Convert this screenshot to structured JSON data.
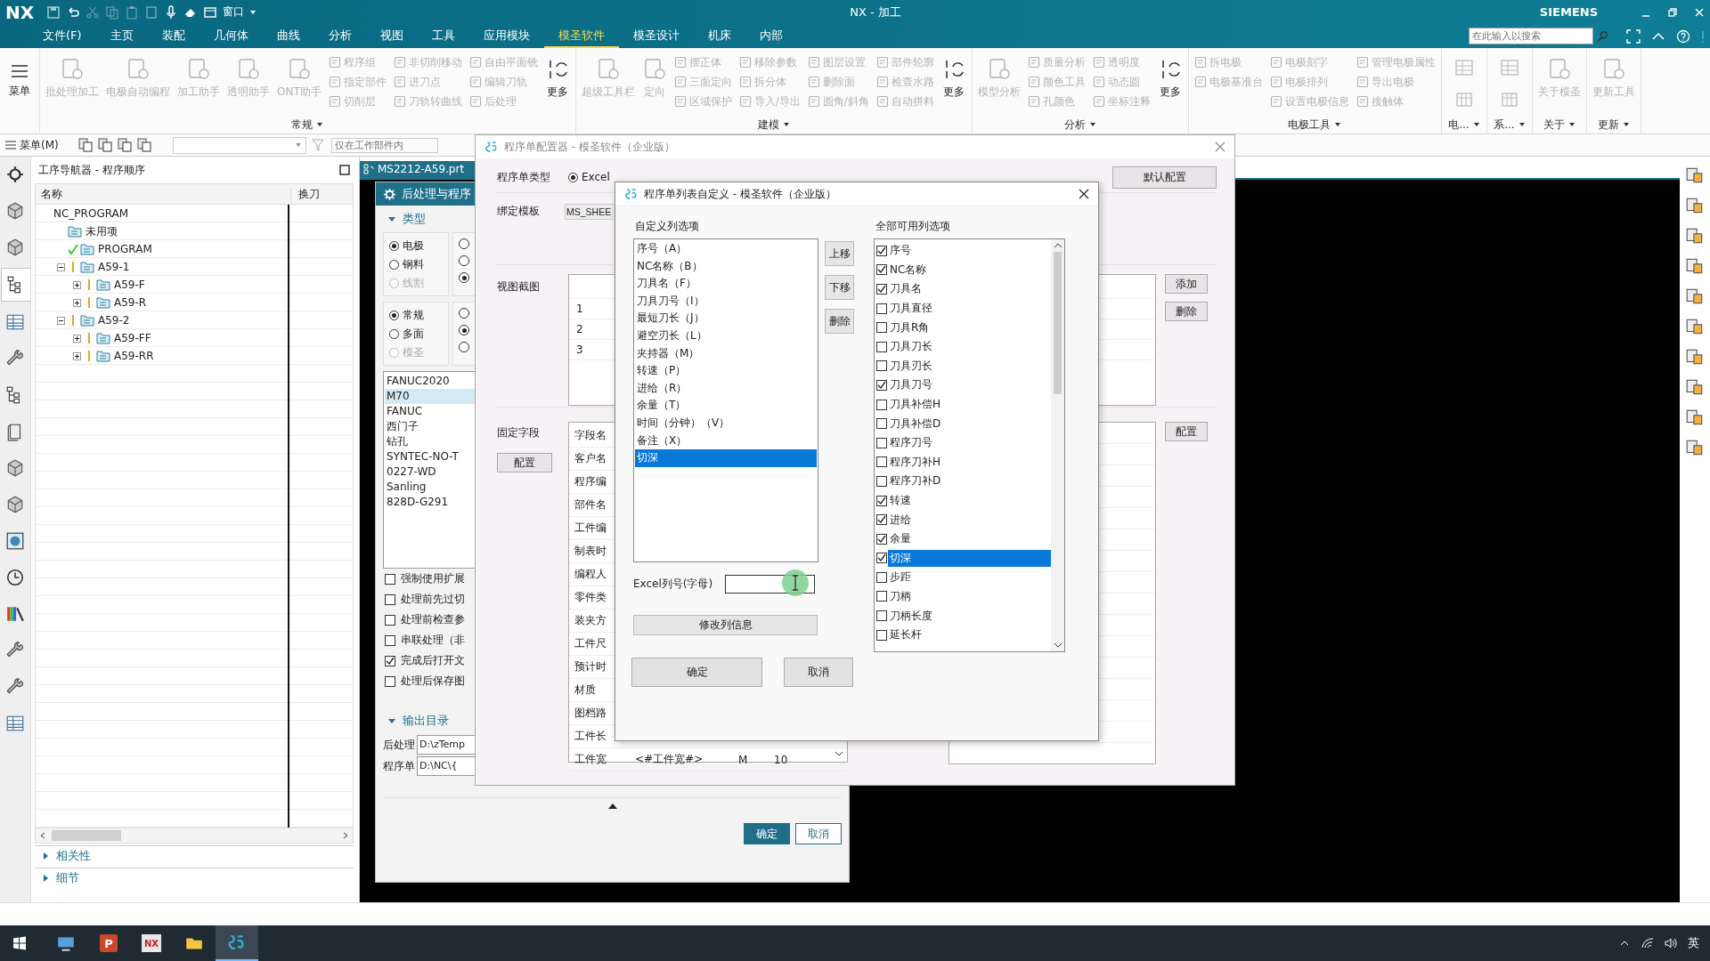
{
  "title_bar": {
    "logo": "NX",
    "window_menu": "窗口",
    "title": "NX - 加工",
    "brand": "SIEMENS"
  },
  "menu_bar": {
    "items": [
      {
        "label": "文件(F)",
        "selected": false
      },
      {
        "label": "主页",
        "selected": false
      },
      {
        "label": "装配",
        "selected": false
      },
      {
        "label": "几何体",
        "selected": false
      },
      {
        "label": "曲线",
        "selected": false
      },
      {
        "label": "分析",
        "selected": false
      },
      {
        "label": "视图",
        "selected": false
      },
      {
        "label": "工具",
        "selected": false
      },
      {
        "label": "应用模块",
        "selected": false
      },
      {
        "label": "模圣软件",
        "selected": true
      },
      {
        "label": "模圣设计",
        "selected": false
      },
      {
        "label": "机床",
        "selected": false
      },
      {
        "label": "内部",
        "selected": false
      }
    ],
    "search": {
      "placeholder": "在此输入以搜索"
    }
  },
  "ribbon": {
    "menu_button": "菜单",
    "groups": [
      {
        "label": "常规",
        "kind": "tools",
        "large": [
          {
            "label": "批处理加工",
            "disabled": true
          },
          {
            "label": "电极自动编程",
            "disabled": true
          },
          {
            "label": "加工助手",
            "disabled": true
          },
          {
            "label": "透明助手",
            "disabled": true
          },
          {
            "label": "ONT助手",
            "disabled": true
          }
        ],
        "columns": [
          [
            {
              "label": "程序组",
              "disabled": true
            },
            {
              "label": "指定部件",
              "disabled": true
            },
            {
              "label": "切削层",
              "disabled": true
            }
          ],
          [
            {
              "label": "非切削移动",
              "disabled": true
            },
            {
              "label": "进刀点",
              "disabled": true
            },
            {
              "label": "刀轨转曲线",
              "disabled": true
            }
          ],
          [
            {
              "label": "自由平面铣",
              "disabled": true
            },
            {
              "label": "编辑刀轨",
              "disabled": true
            },
            {
              "label": "后处理",
              "disabled": true
            }
          ]
        ],
        "more": {
          "label": "更多",
          "disabled": false
        }
      },
      {
        "label": "建模",
        "kind": "tools",
        "large": [
          {
            "label": "超级工具栏",
            "disabled": true
          },
          {
            "label": "定向",
            "disabled": true
          }
        ],
        "columns": [
          [
            {
              "label": "摆正体",
              "disabled": true
            },
            {
              "label": "三面定向",
              "disabled": true
            },
            {
              "label": "区域保护",
              "disabled": true
            }
          ],
          [
            {
              "label": "移除参数",
              "disabled": true
            },
            {
              "label": "拆分体",
              "disabled": true
            },
            {
              "label": "导入/导出",
              "disabled": true
            }
          ],
          [
            {
              "label": "图层设置",
              "disabled": true
            },
            {
              "label": "删除面",
              "disabled": true
            },
            {
              "label": "圆角/斜角",
              "disabled": true
            }
          ],
          [
            {
              "label": "部件轮廓",
              "disabled": true
            },
            {
              "label": "检查水路",
              "disabled": true
            },
            {
              "label": "自动拼料",
              "disabled": true
            }
          ]
        ],
        "more": {
          "label": "更多",
          "disabled": false
        }
      },
      {
        "label": "分析",
        "kind": "tools",
        "large": [
          {
            "label": "模型分析",
            "disabled": true
          }
        ],
        "columns": [
          [
            {
              "label": "质量分析",
              "disabled": true
            },
            {
              "label": "颜色工具",
              "disabled": true
            },
            {
              "label": "孔颜色",
              "disabled": true
            }
          ],
          [
            {
              "label": "透明度",
              "disabled": true
            },
            {
              "label": "动态圆",
              "disabled": true
            },
            {
              "label": "坐标注释",
              "disabled": true
            }
          ]
        ],
        "more": {
          "label": "更多",
          "disabled": false
        }
      },
      {
        "label": "电极工具",
        "kind": "tools",
        "columns": [
          [
            {
              "label": "拆电极",
              "disabled": true
            },
            {
              "label": "电极基准台",
              "disabled": true
            }
          ],
          [
            {
              "label": "电极刻字",
              "disabled": true
            },
            {
              "label": "电极排列",
              "disabled": true
            },
            {
              "label": "设置电极信息",
              "disabled": true
            }
          ],
          [
            {
              "label": "管理电极属性",
              "disabled": true
            },
            {
              "label": "导出电极",
              "disabled": true
            },
            {
              "label": "接触体",
              "disabled": true
            }
          ]
        ]
      },
      {
        "label": "电...",
        "kind": "icons"
      },
      {
        "label": "系...",
        "kind": "icons"
      },
      {
        "label": "关于",
        "kind": "tools",
        "large": [
          {
            "label": "关于模圣",
            "disabled": true
          }
        ]
      },
      {
        "label": "更新",
        "kind": "tools",
        "large": [
          {
            "label": "更新工具",
            "disabled": true
          }
        ]
      }
    ]
  },
  "toolbar": {
    "menu": "菜单(M)",
    "filter": {
      "placeholder": "仅在工作部件内"
    }
  },
  "left_toolbar": [
    {
      "selected": false
    },
    {
      "selected": false
    },
    {
      "selected": false
    },
    {
      "selected": true
    },
    {
      "selected": false
    },
    {
      "selected": false
    },
    {
      "selected": false
    },
    {
      "selected": false
    },
    {
      "selected": false
    },
    {
      "selected": false
    },
    {
      "selected": false
    },
    {
      "selected": false
    },
    {
      "selected": false
    },
    {
      "selected": false
    },
    {
      "selected": false
    },
    {
      "selected": false
    }
  ],
  "navigator": {
    "title": "工序导航器 - 程序顺序",
    "columns": [
      "名称",
      "换刀"
    ],
    "tree": [
      {
        "label": "NC_PROGRAM",
        "children": [
          {
            "label": "未用项"
          },
          {
            "label": "PROGRAM",
            "complete": true
          },
          {
            "label": "A59-1",
            "complete": false,
            "expanded": true,
            "children": [
              {
                "label": "A59-F",
                "complete": false,
                "expanded": false
              },
              {
                "label": "A59-R",
                "complete": false,
                "expanded": false
              }
            ]
          },
          {
            "label": "A59-2",
            "complete": false,
            "expanded": true,
            "children": [
              {
                "label": "A59-FF",
                "complete": false,
                "expanded": false
              },
              {
                "label": "A59-RR",
                "complete": false,
                "expanded": false
              }
            ]
          }
        ]
      }
    ],
    "sections": [
      {
        "label": "相关性",
        "expanded": false
      },
      {
        "label": "细节",
        "expanded": false
      }
    ]
  },
  "graphics": {
    "tab": "MS2212-A59.prt"
  },
  "post_panel": {
    "title": "后处理与程序",
    "type_section": {
      "label": "类型",
      "expanded": true
    },
    "radio_groups": [
      {
        "options": [
          {
            "label": "电极",
            "selected": true,
            "disabled": false
          },
          {
            "label": "钢料",
            "selected": false,
            "disabled": false
          },
          {
            "label": "线割",
            "selected": false,
            "disabled": true
          }
        ],
        "column_2": [
          {
            "selected": false
          },
          {
            "selected": false
          },
          {
            "selected": true
          }
        ]
      },
      {
        "options": [
          {
            "label": "常规",
            "selected": true,
            "disabled": false
          },
          {
            "label": "多面",
            "selected": false,
            "disabled": false
          },
          {
            "label": "模圣",
            "selected": false,
            "disabled": true
          }
        ],
        "column_2": [
          {
            "selected": false
          },
          {
            "selected": true
          },
          {
            "selected": false
          }
        ]
      }
    ],
    "controllers": [
      {
        "label": "FANUC2020",
        "selected": false
      },
      {
        "label": "M70",
        "selected": true
      },
      {
        "label": "FANUC",
        "selected": false
      },
      {
        "label": "西门子",
        "selected": false
      },
      {
        "label": "钻孔",
        "selected": false
      },
      {
        "label": "SYNTEC-NO-T",
        "selected": false
      },
      {
        "label": "0227-WD",
        "selected": false
      },
      {
        "label": "Sanling",
        "selected": false
      },
      {
        "label": "828D-G291",
        "selected": false
      }
    ],
    "options": [
      {
        "label": "强制使用扩展",
        "checked": false
      },
      {
        "label": "处理前先过切",
        "checked": false
      },
      {
        "label": "处理前检查参",
        "checked": false
      },
      {
        "label": "串联处理（非",
        "checked": false
      },
      {
        "label": "完成后打开文",
        "checked": true
      },
      {
        "label": "处理后保存图",
        "checked": false
      }
    ],
    "output_section": {
      "label": "输出目录",
      "expanded": true
    },
    "paths": [
      {
        "label": "后处理",
        "value": "D:\\zTemp"
      },
      {
        "label": "程序单",
        "value": "D:\\NC\\{"
      }
    ],
    "buttons": [
      {
        "label": "确定",
        "primary": true
      },
      {
        "label": "取消",
        "primary": false
      }
    ]
  },
  "configurator": {
    "title": "程序单配置器 - 模圣软件（企业版）",
    "type_label": "程序单类型",
    "type_options": [
      {
        "label": "Excel",
        "selected": true
      }
    ],
    "default_button": "默认配置",
    "template_label": "绑定模板",
    "template_value": "MS_SHEE",
    "view_label": "视图截图",
    "view_rows": [
      "1",
      "2",
      "3"
    ],
    "view_buttons": [
      "添加",
      "删除"
    ],
    "fixed_label": "固定字段",
    "fixed_button": "配置",
    "fixed_rows": [
      [
        "字段名"
      ],
      [
        "客户名"
      ],
      [
        "程序编"
      ],
      [
        "部件名"
      ],
      [
        "工件编"
      ],
      [
        "制表时"
      ],
      [
        "编程人"
      ],
      [
        "零件类"
      ],
      [
        "装夹方"
      ],
      [
        "工件尺"
      ],
      [
        "预计时"
      ],
      [
        "材质"
      ],
      [
        "图档路"
      ],
      [
        "工件长"
      ],
      [
        "工件宽",
        "<#工件宽#>",
        "M",
        "10"
      ]
    ],
    "config_button": "配置"
  },
  "column_dialog": {
    "title": "程序单列表自定义 - 模圣软件（企业版）",
    "custom_label": "自定义列选项",
    "custom_items": [
      {
        "label": "序号（A）",
        "selected": false
      },
      {
        "label": "NC名称（B）",
        "selected": false
      },
      {
        "label": "刀具名（F）",
        "selected": false
      },
      {
        "label": "刀具刀号（I）",
        "selected": false
      },
      {
        "label": "最短刀长（J）",
        "selected": false
      },
      {
        "label": "避空刃长（L）",
        "selected": false
      },
      {
        "label": "夹持器（M）",
        "selected": false
      },
      {
        "label": "转速（P）",
        "selected": false
      },
      {
        "label": "进给（R）",
        "selected": false
      },
      {
        "label": "余量（T）",
        "selected": false
      },
      {
        "label": "时间（分钟）（V）",
        "selected": false
      },
      {
        "label": "备注（X）",
        "selected": false
      },
      {
        "label": "切深",
        "selected": true
      }
    ],
    "move_buttons": [
      "上移",
      "下移",
      "删除"
    ],
    "all_label": "全部可用列选项",
    "all_items": [
      {
        "label": "序号",
        "checked": true,
        "selected": false
      },
      {
        "label": "NC名称",
        "checked": true,
        "selected": false
      },
      {
        "label": "刀具名",
        "checked": true,
        "selected": false
      },
      {
        "label": "刀具直径",
        "checked": false,
        "selected": false
      },
      {
        "label": "刀具R角",
        "checked": false,
        "selected": false
      },
      {
        "label": "刀具刀长",
        "checked": false,
        "selected": false
      },
      {
        "label": "刀具刃长",
        "checked": false,
        "selected": false
      },
      {
        "label": "刀具刀号",
        "checked": true,
        "selected": false
      },
      {
        "label": "刀具补偿H",
        "checked": false,
        "selected": false
      },
      {
        "label": "刀具补偿D",
        "checked": false,
        "selected": false
      },
      {
        "label": "程序刀号",
        "checked": false,
        "selected": false
      },
      {
        "label": "程序刀补H",
        "checked": false,
        "selected": false
      },
      {
        "label": "程序刀补D",
        "checked": false,
        "selected": false
      },
      {
        "label": "转速",
        "checked": true,
        "selected": false
      },
      {
        "label": "进给",
        "checked": true,
        "selected": false
      },
      {
        "label": "余量",
        "checked": true,
        "selected": false
      },
      {
        "label": "切深",
        "checked": true,
        "selected": true
      },
      {
        "label": "步距",
        "checked": false,
        "selected": false
      },
      {
        "label": "刀柄",
        "checked": false,
        "selected": false
      },
      {
        "label": "刀柄长度",
        "checked": false,
        "selected": false
      },
      {
        "label": "延长杆",
        "checked": false,
        "selected": false
      }
    ],
    "column_field": {
      "label": "Excel列号(字母)"
    },
    "modify_button": "修改列信息",
    "buttons": [
      "确定",
      "取消"
    ]
  },
  "taskbar": {
    "apps": [
      {
        "kind": "desktop",
        "selected": false
      },
      {
        "kind": "slides",
        "label": "P",
        "selected": false
      },
      {
        "kind": "nx",
        "label": "NX",
        "selected": false
      },
      {
        "kind": "folder",
        "selected": false
      },
      {
        "kind": "app",
        "selected": true
      }
    ],
    "ime": "英"
  }
}
